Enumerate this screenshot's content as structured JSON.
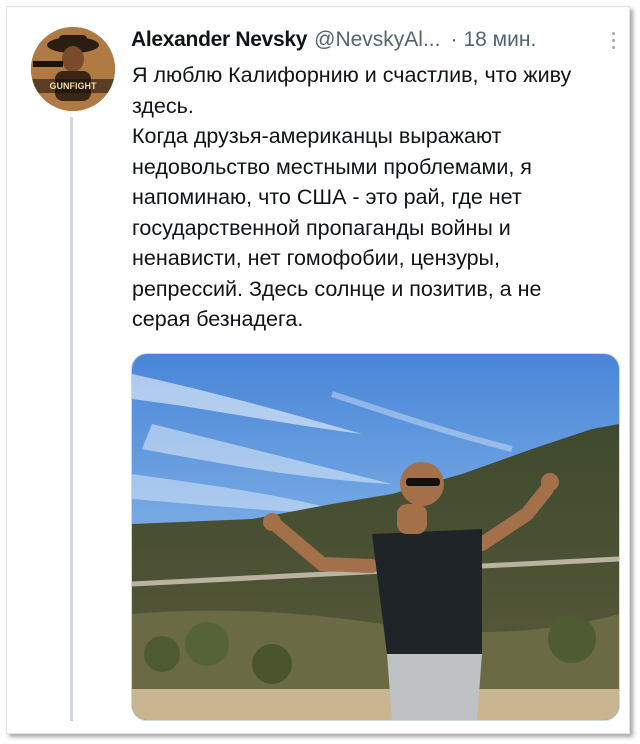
{
  "tweet": {
    "author_name": "Alexander Nevsky",
    "author_handle": "@NevskyAl...",
    "separator": "·",
    "timestamp": "18 мин.",
    "paragraphs": [
      "Я люблю Калифорнию и счастлив, что живу здесь.",
      "Когда друзья-американцы выражают недовольство местными проблемами, я напоминаю, что США - это рай, где нет государственной пропаганды войны и ненависти, нет гомофобии, цензуры, репрессий. Здесь солнце и позитив, а не серая безнадега."
    ],
    "avatar_text": "GUNFIGHT"
  },
  "icons": {
    "more": "more-options-icon"
  },
  "colors": {
    "text": "#0f1419",
    "secondary": "#536471",
    "thread_line": "#cfd9de"
  }
}
